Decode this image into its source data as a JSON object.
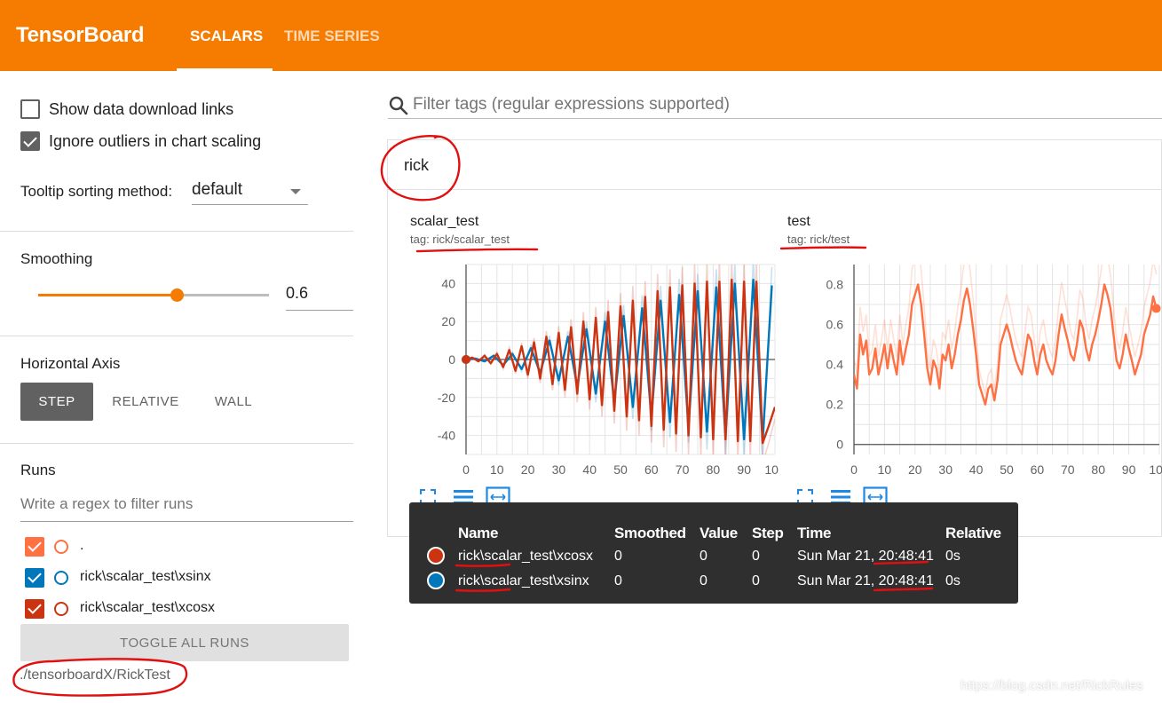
{
  "header": {
    "brand": "TensorBoard",
    "tabs": [
      {
        "label": "SCALARS",
        "active": true
      },
      {
        "label": "TIME SERIES",
        "active": false
      }
    ],
    "color": "#f57c00"
  },
  "sidebar": {
    "show_download_links": {
      "label": "Show data download links",
      "checked": false
    },
    "ignore_outliers": {
      "label": "Ignore outliers in chart scaling",
      "checked": true
    },
    "tooltip_sorting": {
      "label": "Tooltip sorting method:",
      "value": "default"
    },
    "smoothing": {
      "label": "Smoothing",
      "value": "0.6",
      "fraction": 0.6
    },
    "horizontal_axis": {
      "label": "Horizontal Axis",
      "options": [
        "STEP",
        "RELATIVE",
        "WALL"
      ],
      "selected": "STEP"
    },
    "runs": {
      "label": "Runs",
      "filter_placeholder": "Write a regex to filter runs",
      "items": [
        {
          "name": ".",
          "color": "#ff7043",
          "checked": true
        },
        {
          "name": "rick\\scalar_test\\xsinx",
          "color": "#0077bb",
          "checked": true
        },
        {
          "name": "rick\\scalar_test\\xcosx",
          "color": "#cc3311",
          "checked": true
        }
      ],
      "toggle_label": "TOGGLE ALL RUNS",
      "logdir": "./tensorboardX/RickTest"
    }
  },
  "filter": {
    "placeholder": "Filter tags (regular expressions supported)"
  },
  "group": {
    "name": "rick"
  },
  "chart_data": [
    {
      "type": "line",
      "title": "scalar_test",
      "subtitle": "tag: rick/scalar_test",
      "x_ticks": [
        "0",
        "10",
        "20",
        "30",
        "40",
        "50",
        "60",
        "70",
        "80",
        "90",
        "100"
      ],
      "y_ticks": [
        "40",
        "20",
        "0",
        "-20",
        "-40"
      ],
      "xlim": [
        0,
        100
      ],
      "ylim": [
        -50,
        50
      ],
      "grid": true,
      "series": [
        {
          "name": "rick\\scalar_test\\xsinx",
          "color": "#0077bb",
          "x": [
            0,
            3,
            6,
            9,
            12,
            15,
            18,
            21,
            24,
            27,
            30,
            33,
            36,
            39,
            42,
            45,
            48,
            51,
            54,
            57,
            60,
            63,
            66,
            69,
            72,
            75,
            78,
            81,
            84,
            87,
            90,
            93,
            96,
            99
          ],
          "y": [
            0,
            0.5,
            -1,
            2,
            -3,
            3,
            -5,
            6,
            -7,
            10,
            -11,
            12,
            -14,
            16,
            -18,
            20,
            -22,
            23,
            -25,
            27,
            -30,
            31,
            -33,
            34,
            -35,
            36,
            -38,
            38,
            -40,
            40,
            -42,
            42,
            -43,
            39
          ]
        },
        {
          "name": "rick\\scalar_test\\xcosx",
          "color": "#cc3311",
          "x": [
            0,
            2,
            4,
            6,
            8,
            10,
            12,
            14,
            16,
            18,
            20,
            22,
            24,
            26,
            28,
            30,
            32,
            34,
            36,
            38,
            40,
            42,
            44,
            46,
            48,
            50,
            52,
            54,
            56,
            58,
            60,
            62,
            64,
            66,
            68,
            70,
            72,
            74,
            76,
            78,
            80,
            82,
            84,
            86,
            88,
            90,
            92,
            94,
            96,
            98,
            100
          ],
          "y": [
            0,
            1,
            -1,
            2,
            -2,
            3,
            -4,
            5,
            -6,
            7,
            -8,
            9,
            -10,
            12,
            -13,
            14,
            -16,
            17,
            -18,
            20,
            -21,
            22,
            -24,
            25,
            -27,
            28,
            -30,
            31,
            -32,
            33,
            -35,
            36,
            -37,
            38,
            -39,
            39,
            -40,
            40,
            -41,
            41,
            -42,
            41,
            -42,
            42,
            -43,
            41,
            -43,
            41,
            -44,
            -35,
            -25
          ]
        }
      ]
    },
    {
      "type": "line",
      "title": "test",
      "subtitle": "tag: rick/test",
      "x_ticks": [
        "0",
        "10",
        "20",
        "30",
        "40",
        "50",
        "60",
        "70",
        "80",
        "90",
        "100"
      ],
      "y_ticks": [
        "0.8",
        "0.6",
        "0.4",
        "0.2",
        "0"
      ],
      "xlim": [
        0,
        100
      ],
      "ylim": [
        -0.05,
        0.9
      ],
      "grid": true,
      "series": [
        {
          "name": ".",
          "color": "#ff7043",
          "x": [
            0,
            1,
            2,
            3,
            4,
            5,
            6,
            7,
            8,
            9,
            10,
            11,
            12,
            13,
            14,
            15,
            16,
            17,
            18,
            19,
            20,
            21,
            22,
            23,
            24,
            25,
            26,
            27,
            28,
            29,
            30,
            31,
            32,
            33,
            34,
            35,
            36,
            37,
            38,
            39,
            40,
            41,
            42,
            43,
            44,
            45,
            46,
            47,
            48,
            49,
            50,
            51,
            52,
            53,
            54,
            55,
            56,
            57,
            58,
            59,
            60,
            61,
            62,
            63,
            64,
            65,
            66,
            67,
            68,
            69,
            70,
            71,
            72,
            73,
            74,
            75,
            76,
            77,
            78,
            79,
            80,
            81,
            82,
            83,
            84,
            85,
            86,
            87,
            88,
            89,
            90,
            91,
            92,
            93,
            94,
            95,
            96,
            97,
            98,
            99
          ],
          "y": [
            0.35,
            0.28,
            0.55,
            0.45,
            0.52,
            0.35,
            0.38,
            0.48,
            0.35,
            0.42,
            0.5,
            0.38,
            0.5,
            0.42,
            0.35,
            0.52,
            0.4,
            0.48,
            0.55,
            0.7,
            0.75,
            0.8,
            0.7,
            0.55,
            0.38,
            0.3,
            0.42,
            0.38,
            0.28,
            0.45,
            0.42,
            0.5,
            0.38,
            0.45,
            0.55,
            0.62,
            0.72,
            0.78,
            0.7,
            0.58,
            0.45,
            0.3,
            0.25,
            0.2,
            0.28,
            0.3,
            0.22,
            0.32,
            0.5,
            0.55,
            0.6,
            0.55,
            0.48,
            0.42,
            0.38,
            0.35,
            0.45,
            0.55,
            0.52,
            0.42,
            0.35,
            0.45,
            0.5,
            0.42,
            0.38,
            0.35,
            0.42,
            0.55,
            0.65,
            0.58,
            0.52,
            0.45,
            0.42,
            0.5,
            0.62,
            0.58,
            0.48,
            0.42,
            0.5,
            0.55,
            0.62,
            0.7,
            0.8,
            0.75,
            0.68,
            0.55,
            0.42,
            0.38,
            0.45,
            0.55,
            0.48,
            0.42,
            0.35,
            0.4,
            0.45,
            0.55,
            0.6,
            0.65,
            0.74,
            0.68
          ]
        }
      ]
    }
  ],
  "tooltip": {
    "headers": {
      "name": "Name",
      "smoothed": "Smoothed",
      "value": "Value",
      "step": "Step",
      "time": "Time",
      "relative": "Relative"
    },
    "rows": [
      {
        "color": "#cc3311",
        "name": "rick\\scalar_test\\xcosx",
        "smoothed": "0",
        "value": "0",
        "step": "0",
        "time": "Sun Mar 21, 20:48:41",
        "relative": "0s"
      },
      {
        "color": "#0077bb",
        "name": "rick\\scalar_test\\xsinx",
        "smoothed": "0",
        "value": "0",
        "step": "0",
        "time": "Sun Mar 21, 20:48:41",
        "relative": "0s"
      }
    ]
  },
  "watermark": "https://blog.csdn.net/RickRules"
}
